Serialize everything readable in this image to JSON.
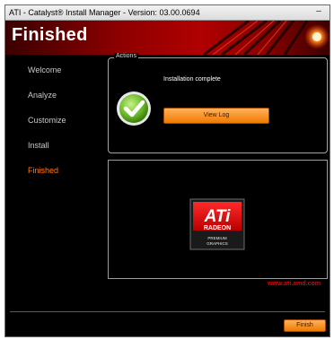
{
  "window": {
    "title": "ATI - Catalyst® Install Manager - Version: 03.00.0694",
    "minimize_glyph": "–"
  },
  "header": {
    "title": "Finished"
  },
  "sidebar": {
    "items": [
      {
        "label": "Welcome",
        "active": false
      },
      {
        "label": "Analyze",
        "active": false
      },
      {
        "label": "Customize",
        "active": false
      },
      {
        "label": "Install",
        "active": false
      },
      {
        "label": "Finished",
        "active": true
      }
    ]
  },
  "actions": {
    "legend": "Actions",
    "status_text": "Installation complete",
    "view_log_label": "View Log",
    "status_icon": "check-icon"
  },
  "logo": {
    "brand": "ATi",
    "product": "RADEON",
    "tagline_line1": "PREMIUM",
    "tagline_line2": "GRAPHICS"
  },
  "footer": {
    "url": "www.ati.amd.com",
    "finish_label": "Finish"
  },
  "colors": {
    "accent_orange": "#ff7a1a",
    "brand_red": "#e00000",
    "button_orange": "#f07a00"
  }
}
